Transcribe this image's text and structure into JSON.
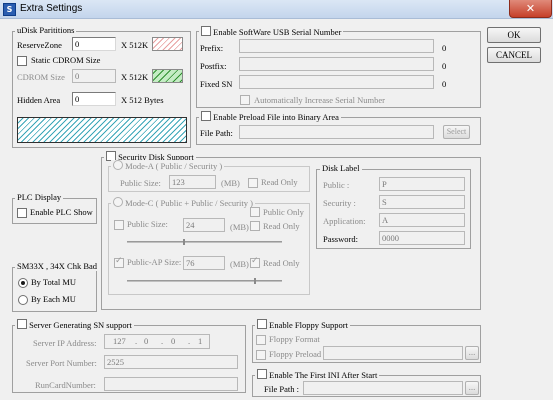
{
  "window": {
    "title": "Extra Settings",
    "icon": "app-icon",
    "close_glyph": "✕"
  },
  "buttons": {
    "ok": "OK",
    "cancel": "CANCEL"
  },
  "udisk": {
    "group_label": "uDisk Parititions",
    "reserve_zone_label": "ReserveZone",
    "reserve_zone_value": "0",
    "reserve_zone_unit": "X 512K",
    "static_cdrom_label": "Static CDROM Size",
    "static_cdrom_checked": false,
    "cdrom_size_label": "CDROM Size",
    "cdrom_size_value": "0",
    "cdrom_size_unit": "X 512K",
    "hidden_area_label": "Hidden Area",
    "hidden_area_value": "0",
    "hidden_area_unit": "X 512 Bytes",
    "colors": {
      "reserve_swatch": "#e8a0a0",
      "cdrom_swatch": "#2f8f2f",
      "partition_bar": "#3aa6b8"
    }
  },
  "usb_serial": {
    "enable_label": "Enable SoftWare USB Serial Number",
    "enabled": false,
    "prefix_label": "Prefix:",
    "prefix_count": "0",
    "postfix_label": "Postfix:",
    "postfix_count": "0",
    "fixed_sn_label": "Fixed SN",
    "fixed_sn_count": "0",
    "auto_increase_label": "Automatically Increase Serial Number"
  },
  "preload": {
    "enable_label": "Enable Preload File into Binary Area",
    "file_path_label": "File Path:",
    "select_label": "Select"
  },
  "plc": {
    "group_label": "PLC Display",
    "enable_label": "Enable PLC Show"
  },
  "chk_bad": {
    "group_label": "SM33X , 34X Chk Bad",
    "by_total_label": "By Total MU",
    "by_each_label": "By Each MU",
    "selected": "by_total"
  },
  "security": {
    "enable_label": "Security Disk Support",
    "mode_a_label": "Mode-A ( Public / Security )",
    "public_size_label": "Public Size:",
    "public_size_value": "123",
    "unit_mb": "(MB)",
    "read_only_label": "Read Only",
    "mode_c_label": "Mode-C ( Public + Public / Security )",
    "public_only_label": "Public Only",
    "public_size2_label": "Public Size:",
    "public_size2_value": "24",
    "read_only2_label": "Read Only",
    "public_ap_label": "Public-AP Size:",
    "public_ap_value": "76",
    "read_only3_label": "Read Only",
    "public_ap_checked": true,
    "read_only3_checked": true,
    "slider1_level": 0.36,
    "slider2_level": 0.82
  },
  "disk_label": {
    "group_label": "Disk Label",
    "public_label": "Public :",
    "public_value": "P",
    "security_label": "Security :",
    "security_value": "S",
    "application_label": "Application:",
    "application_value": "A",
    "password_label": "Password:",
    "password_value": "0000"
  },
  "sn_server": {
    "enable_label": "Server Generating SN support",
    "ip_label": "Server IP Address:",
    "ip": [
      "127",
      "0",
      "0",
      "1"
    ],
    "port_label": "Server Port Number:",
    "port_value": "2525",
    "runcard_label": "RunCardNumber:"
  },
  "floppy": {
    "enable_label": "Enable Floppy Support",
    "format_label": "Floppy Format",
    "preload_label": "Floppy Preload",
    "browse": "..."
  },
  "first_ini": {
    "enable_label": "Enable The First INI After Start",
    "file_path_label": "File Path :",
    "browse": "..."
  }
}
